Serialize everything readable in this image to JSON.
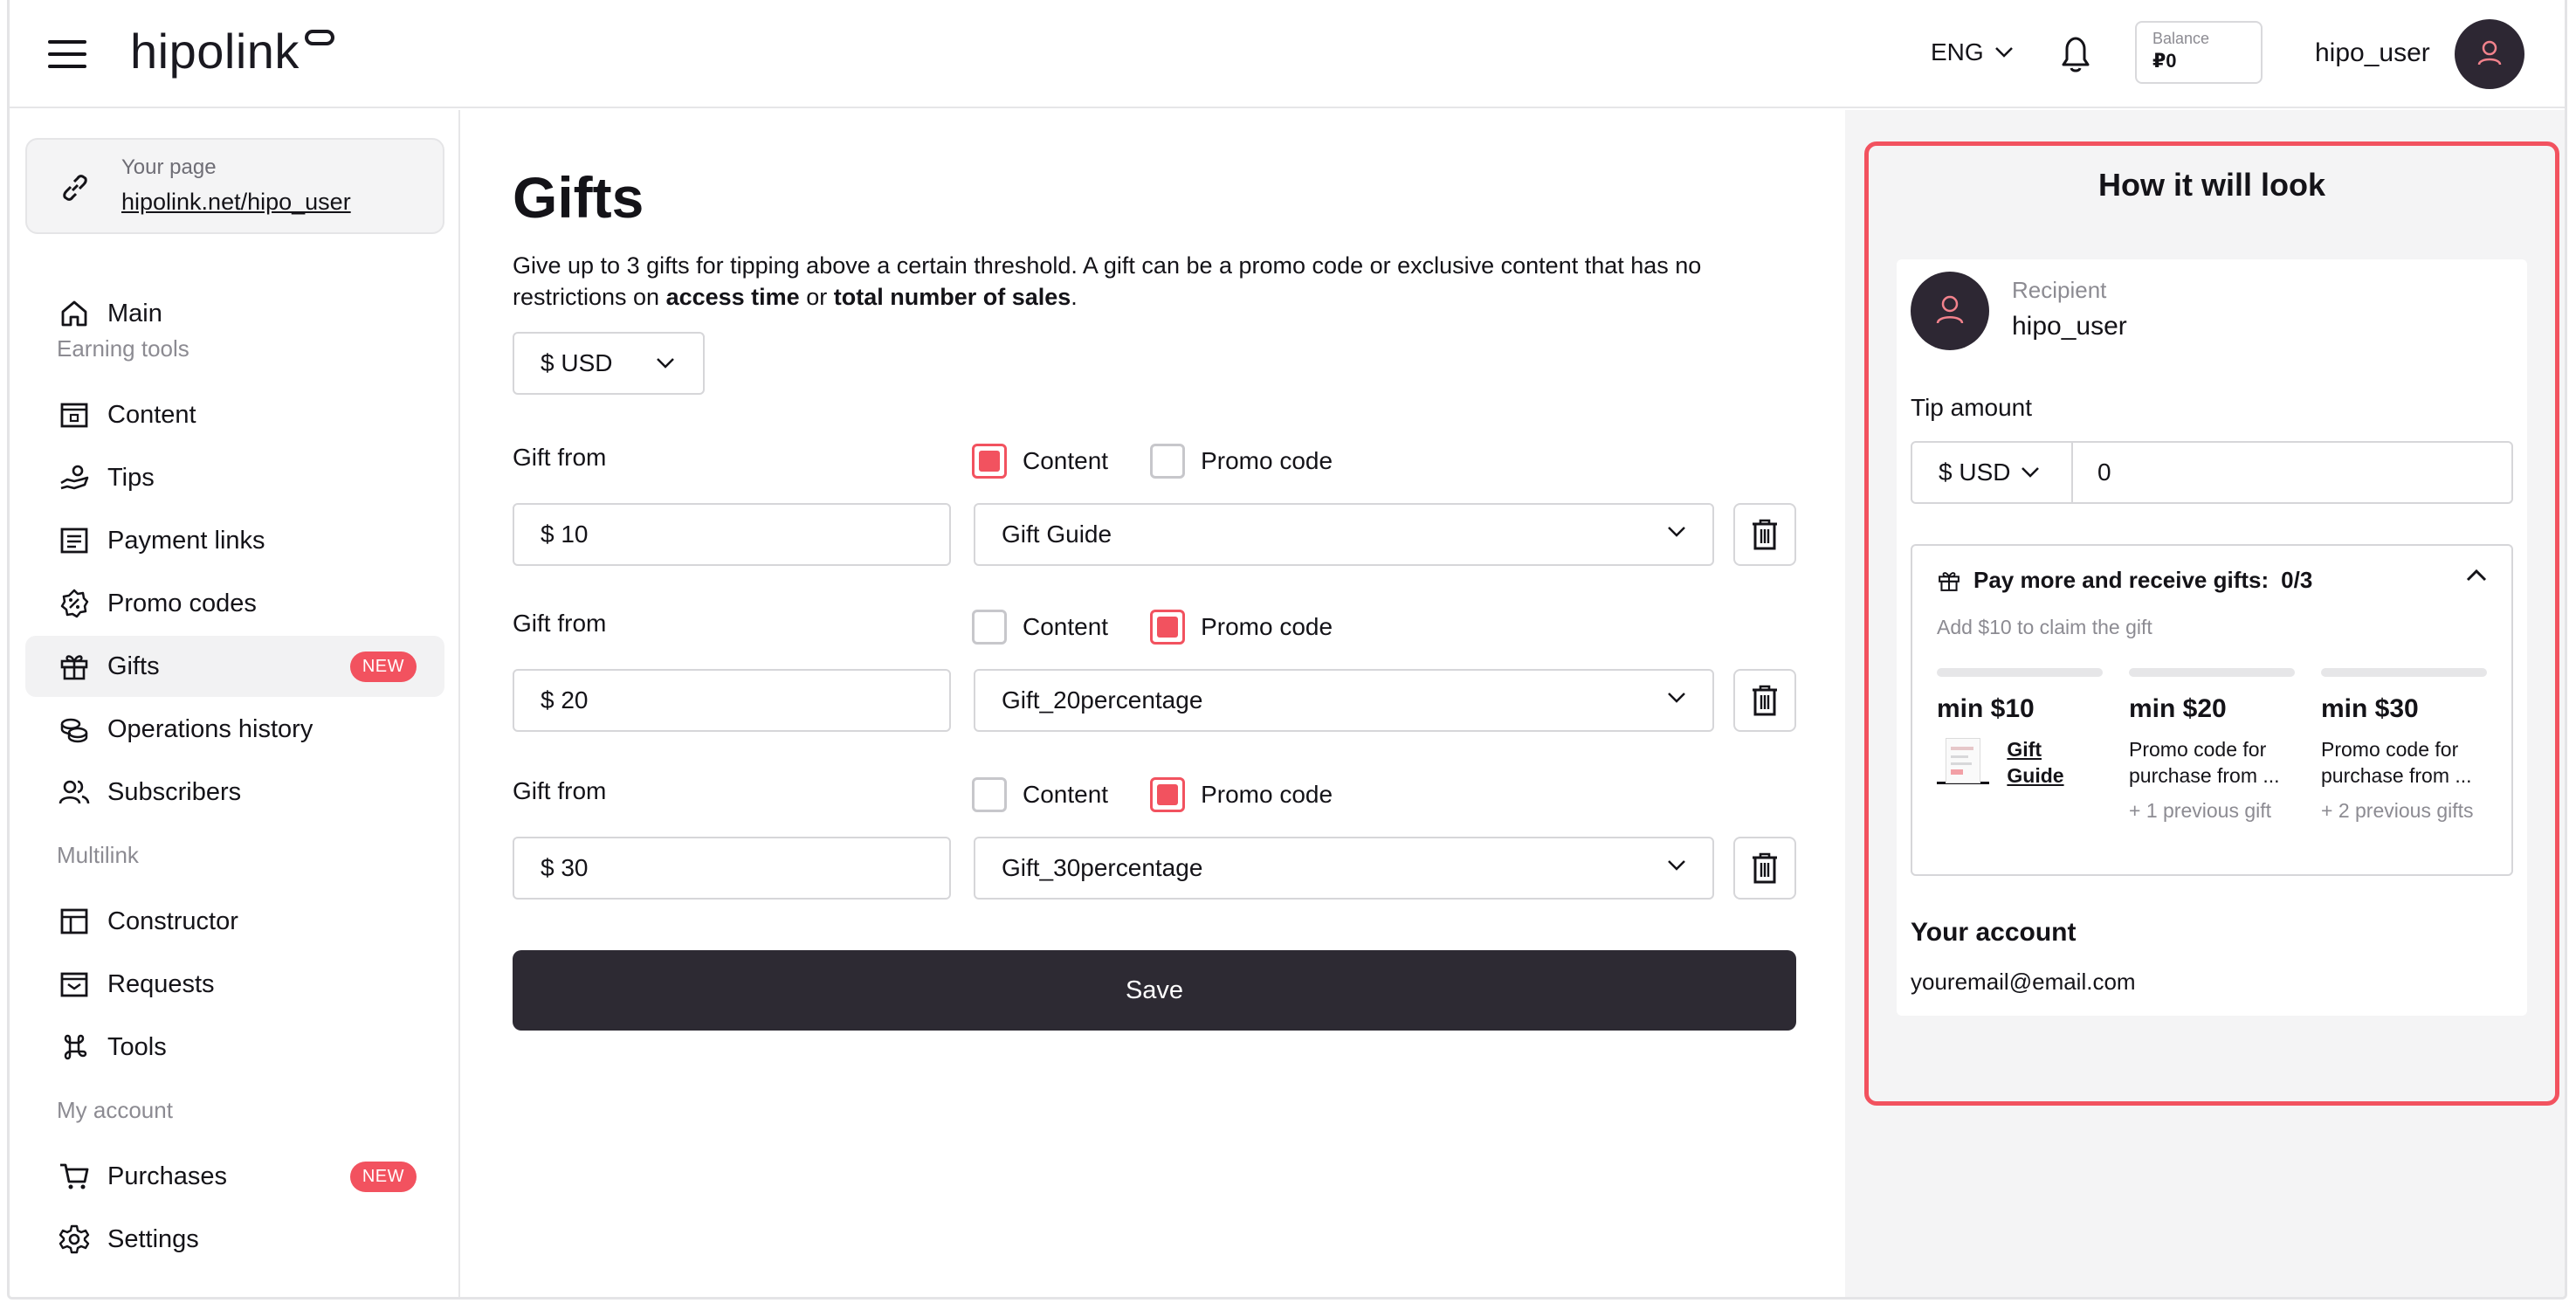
{
  "header": {
    "logo": "hipolink",
    "language": "ENG",
    "balance_label": "Balance",
    "balance_value": "₽0",
    "username": "hipo_user"
  },
  "sidebar": {
    "page_label": "Your page",
    "page_link": "hipolink.net/hipo_user",
    "main": "Main",
    "section_earning": "Earning tools",
    "content": "Content",
    "tips": "Tips",
    "payment_links": "Payment links",
    "promo_codes": "Promo codes",
    "gifts": "Gifts",
    "gifts_badge": "NEW",
    "operations_history": "Operations history",
    "subscribers": "Subscribers",
    "section_multilink": "Multilink",
    "constructor": "Constructor",
    "requests": "Requests",
    "tools": "Tools",
    "section_account": "My account",
    "purchases": "Purchases",
    "purchases_badge": "NEW",
    "settings": "Settings"
  },
  "main": {
    "title": "Gifts",
    "desc_a": "Give up to 3 gifts for tipping above a certain threshold. A gift can be a promo code or exclusive content that has no restrictions on ",
    "desc_b": "access time",
    "desc_c": " or ",
    "desc_d": "total number of sales",
    "desc_e": ".",
    "currency": "$ USD",
    "gift_from": "Gift from",
    "content_label": "Content",
    "promo_label": "Promo code",
    "rows": [
      {
        "amount": "$ 10",
        "item": "Gift Guide",
        "type": "content"
      },
      {
        "amount": "$ 20",
        "item": "Gift_20percentage",
        "type": "promo"
      },
      {
        "amount": "$ 30",
        "item": "Gift_30percentage",
        "type": "promo"
      }
    ],
    "save": "Save"
  },
  "preview": {
    "title": "How it will look",
    "recipient_label": "Recipient",
    "recipient_name": "hipo_user",
    "tip_label": "Tip amount",
    "tip_currency": "$ USD",
    "tip_value": "0",
    "gifts_head": "Pay more and receive gifts:",
    "gifts_count": "0/3",
    "gifts_sub": "Add $10 to claim the gift",
    "tiers": [
      {
        "min": "min $10",
        "name_1": "Gift",
        "name_2": "Guide",
        "prev": ""
      },
      {
        "min": "min $20",
        "name": "Promo code for purchase from ...",
        "prev": "+ 1  previous gift"
      },
      {
        "min": "min $30",
        "name": "Promo code for purchase from ...",
        "prev": "+ 2  previous gifts"
      }
    ],
    "account_label": "Your account",
    "account_email": "youremail@email.com"
  },
  "colors": {
    "accent": "#f2525f",
    "dark": "#2d2a33"
  }
}
